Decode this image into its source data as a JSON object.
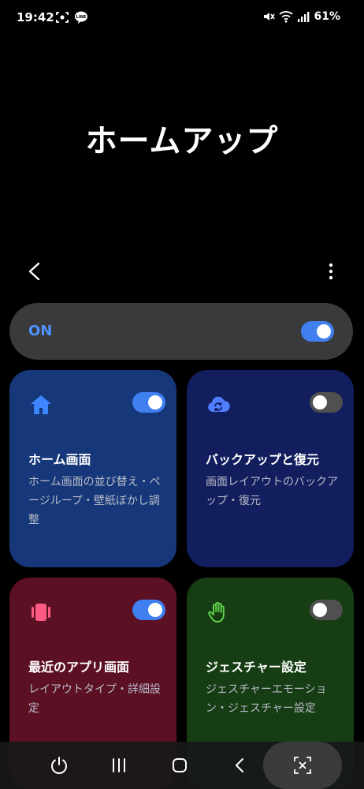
{
  "status_bar": {
    "time": "19:42",
    "battery_text": "61%",
    "icons_left": [
      "screenshot-icon",
      "line-app-icon"
    ],
    "icons_right": [
      "mute-icon",
      "wifi-icon",
      "signal-icon"
    ]
  },
  "page": {
    "title": "ホームアップ"
  },
  "toolbar": {
    "back_icon": "chevron-left-icon",
    "more_icon": "more-vertical-icon"
  },
  "master_switch": {
    "label": "ON",
    "checked": true,
    "label_color": "#4e93ff"
  },
  "cards": [
    {
      "id": "home",
      "icon": "home-icon",
      "icon_color": "#3d86ff",
      "title": "ホーム画面",
      "description": "ホーム画面の並び替え・ページループ・壁紙ぼかし調整",
      "checked": true,
      "background": "#163779"
    },
    {
      "id": "backup",
      "icon": "cloud-sync-icon",
      "icon_color": "#4f7dff",
      "title": "バックアップと復元",
      "description": "画面レイアウトのバックアップ・復元",
      "checked": false,
      "background": "#121e5e"
    },
    {
      "id": "recents",
      "icon": "recent-apps-icon",
      "icon_color": "#ff5a84",
      "title": "最近のアプリ画面",
      "description": "レイアウトタイプ・詳細設定",
      "checked": true,
      "background": "#5c1024"
    },
    {
      "id": "gesture",
      "icon": "hand-icon",
      "icon_color": "#5fd34a",
      "title": "ジェスチャー設定",
      "description": "ジェスチャーエモーション・ジェスチャー設定",
      "checked": false,
      "background": "#163d14"
    }
  ],
  "nav_bar": {
    "buttons": [
      "power-icon",
      "recents-nav-icon",
      "home-nav-icon",
      "back-nav-icon",
      "capture-icon"
    ]
  },
  "colors": {
    "toggle_on": "#3f7ff0",
    "toggle_off": "#505050",
    "master_switch_bg": "#3a3a3c"
  }
}
